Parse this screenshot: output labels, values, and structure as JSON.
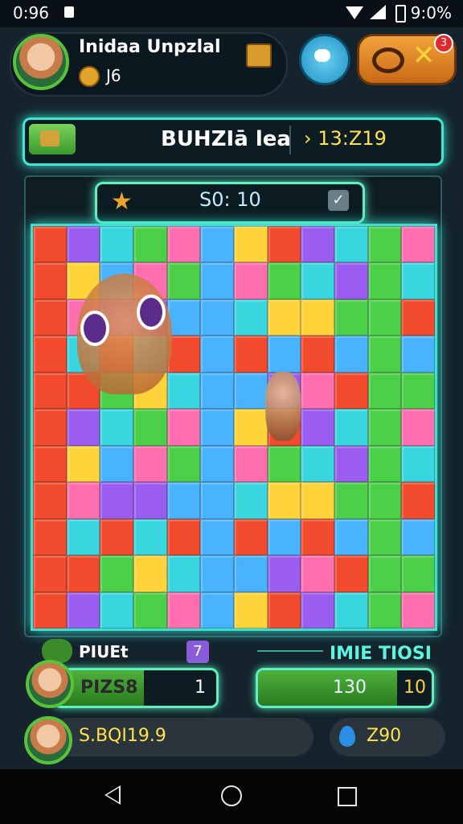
{
  "status_bar": {
    "time": "0:96",
    "battery_text": "9:0%"
  },
  "header": {
    "player_name": "Inidaa Unpzlal",
    "coins": "J6",
    "notification_count": "3"
  },
  "level": {
    "title": "BUHZIā lea",
    "timer": "› 13:Z19",
    "score": "S0: 10"
  },
  "board": {
    "rows": 11,
    "columns": 12,
    "piece_colors": [
      "#f24a2c",
      "#4ab3ff",
      "#4cd04a",
      "#9b5cf0",
      "#ffd43a",
      "#ff6fb0",
      "#3ad6e0"
    ]
  },
  "player_panel": {
    "label": "PIUEt",
    "level_badge": "7",
    "progress_value": "PIZS8",
    "progress_count": "1",
    "progress_fraction": 0.55
  },
  "time_panel": {
    "label": "IMIE TIOSI",
    "value": "130",
    "count": "10",
    "progress_fraction": 0.8
  },
  "bottom": {
    "bank_text": "S.BQI19.9",
    "gems": "Z90"
  }
}
